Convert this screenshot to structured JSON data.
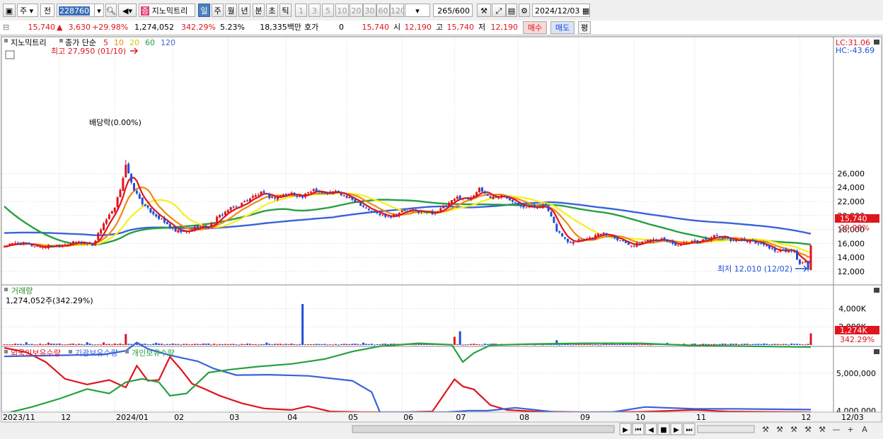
{
  "toolbar": {
    "period_main": "주",
    "prev": "전",
    "stock_code": "228760",
    "stock_name": "지노믹트리",
    "stock_badge": "증",
    "periods": [
      "일",
      "주",
      "월",
      "년",
      "분",
      "초",
      "틱"
    ],
    "selected_period": "일",
    "intervals": [
      "1",
      "3",
      "5",
      "10",
      "20",
      "30",
      "60",
      "120"
    ],
    "count": "265",
    "count_total": "/600",
    "date": "2024/12/03"
  },
  "info": {
    "price": "15,740",
    "change": "3,630",
    "change_pct": "+29.98%",
    "volume": "1,274,052",
    "volume_ratio": "342.29%",
    "turnover": "5.23%",
    "amount": "18,335백만",
    "quote_label": "호가",
    "quote_value": "0",
    "quote_price": "15,740",
    "open_label": "시",
    "open": "12,190",
    "high_label": "고",
    "high": "15,740",
    "low_label": "저",
    "low": "12,190",
    "buy": "매수",
    "sell": "매도",
    "eval": "평"
  },
  "colors": {
    "up": "#e0141e",
    "down": "#1f4fd6",
    "ma5": "#e0141e",
    "ma10": "#f08a10",
    "ma20": "#f5f01e",
    "ma60": "#27a040",
    "ma120": "#3a63d8"
  },
  "legend": {
    "name": "지노믹트리",
    "indicator": "종가 단순",
    "periods": [
      "5",
      "10",
      "20",
      "60",
      "120"
    ]
  },
  "annotations": {
    "high": "최고 27,950 (01/10)",
    "low": "최저 12,010 (12/02)",
    "dividend": "배당락(0.00%)",
    "lc": "LC:31.06",
    "hc": "HC:-43.69",
    "last_price": "15,740",
    "last_pct": "29.98%",
    "volume_title": "거래량",
    "volume_value": "1,274,052주(342.29%)",
    "last_volume": "1,274K",
    "last_volume_pct": "342.29%",
    "holdings_legend": [
      "외국인보유수량",
      "기관보유수량",
      "개인보유수량"
    ]
  },
  "chart_data": [
    {
      "type": "candlestick",
      "title": "지노믹트리 일봉",
      "x_labels": [
        "2023/11",
        "12",
        "2024/01",
        "02",
        "03",
        "04",
        "05",
        "06",
        "07",
        "08",
        "09",
        "10",
        "11",
        "12"
      ],
      "y_ticks": [
        12000,
        14000,
        16000,
        18000,
        20000,
        22000,
        24000,
        26000
      ],
      "ylim": [
        11000,
        28500
      ],
      "anchors": [
        [
          0,
          15600
        ],
        [
          5,
          16100
        ],
        [
          10,
          15700
        ],
        [
          14,
          15500
        ],
        [
          20,
          15800
        ],
        [
          27,
          16200
        ],
        [
          32,
          15800
        ],
        [
          36,
          18900
        ],
        [
          40,
          21000
        ],
        [
          42,
          23800
        ],
        [
          43,
          25500
        ],
        [
          44,
          27300
        ],
        [
          46,
          24500
        ],
        [
          48,
          23000
        ],
        [
          51,
          21200
        ],
        [
          54,
          20300
        ],
        [
          58,
          19000
        ],
        [
          62,
          17700
        ],
        [
          66,
          17600
        ],
        [
          70,
          18500
        ],
        [
          74,
          18300
        ],
        [
          77,
          19600
        ],
        [
          81,
          20800
        ],
        [
          85,
          21400
        ],
        [
          89,
          22500
        ],
        [
          93,
          23200
        ],
        [
          97,
          22500
        ],
        [
          101,
          22900
        ],
        [
          104,
          23200
        ],
        [
          108,
          22600
        ],
        [
          112,
          23800
        ],
        [
          116,
          23000
        ],
        [
          120,
          23400
        ],
        [
          124,
          22600
        ],
        [
          128,
          21900
        ],
        [
          132,
          20800
        ],
        [
          136,
          20100
        ],
        [
          140,
          19900
        ],
        [
          144,
          20600
        ],
        [
          148,
          20700
        ],
        [
          152,
          20400
        ],
        [
          156,
          20400
        ],
        [
          160,
          21400
        ],
        [
          164,
          22600
        ],
        [
          168,
          22400
        ],
        [
          172,
          23700
        ],
        [
          176,
          22600
        ],
        [
          180,
          22800
        ],
        [
          184,
          22200
        ],
        [
          188,
          21300
        ],
        [
          192,
          21200
        ],
        [
          196,
          21400
        ],
        [
          200,
          17900
        ],
        [
          204,
          16200
        ],
        [
          208,
          16600
        ],
        [
          212,
          16800
        ],
        [
          216,
          17400
        ],
        [
          220,
          17100
        ],
        [
          224,
          16300
        ],
        [
          228,
          15700
        ],
        [
          232,
          16400
        ],
        [
          236,
          16700
        ],
        [
          240,
          16300
        ],
        [
          244,
          15700
        ],
        [
          248,
          16100
        ],
        [
          252,
          16300
        ],
        [
          256,
          17000
        ],
        [
          260,
          16900
        ],
        [
          264,
          16500
        ],
        [
          268,
          16500
        ],
        [
          272,
          16200
        ],
        [
          276,
          15600
        ],
        [
          280,
          14800
        ],
        [
          283,
          15000
        ],
        [
          286,
          14700
        ],
        [
          288,
          13000
        ],
        [
          290,
          13300
        ],
        [
          291,
          12400
        ],
        [
          292,
          15740
        ]
      ],
      "annotations": [
        "최고 27,950 (01/10)",
        "최저 12,010 (12/02)",
        "배당락(0.00%)"
      ],
      "moving_averages": [
        5,
        10,
        20,
        60,
        120
      ],
      "last": {
        "price": 15740,
        "open": 12190,
        "high": 15740,
        "low": 12190,
        "change": 3630,
        "change_pct": 29.98
      }
    },
    {
      "type": "bar",
      "title": "거래량",
      "y_ticks": [
        2000000,
        4000000
      ],
      "ylim": [
        0,
        4600000
      ],
      "spikes": [
        [
          8,
          300000
        ],
        [
          16,
          260000
        ],
        [
          30,
          300000
        ],
        [
          36,
          280000
        ],
        [
          44,
          1200000
        ],
        [
          55,
          240000
        ],
        [
          95,
          260000
        ],
        [
          108,
          4500000
        ],
        [
          130,
          250000
        ],
        [
          150,
          230000
        ],
        [
          163,
          900000
        ],
        [
          165,
          1500000
        ],
        [
          200,
          520000
        ],
        [
          240,
          230000
        ],
        [
          292,
          1274052
        ]
      ],
      "last_volume": 1274052,
      "last_volume_ratio_pct": 342.29
    },
    {
      "type": "line",
      "title": "보유수량",
      "series": [
        {
          "name": "외국인보유수량",
          "values": [
            [
              0,
              5680000
            ],
            [
              8,
              5560000
            ],
            [
              15,
              5300000
            ],
            [
              22,
              4850000
            ],
            [
              30,
              4700000
            ],
            [
              38,
              4820000
            ],
            [
              44,
              4620000
            ],
            [
              48,
              5200000
            ],
            [
              52,
              4800000
            ],
            [
              56,
              4820000
            ],
            [
              60,
              5440000
            ],
            [
              64,
              5100000
            ],
            [
              68,
              4720000
            ],
            [
              72,
              4600000
            ],
            [
              78,
              4400000
            ],
            [
              86,
              4200000
            ],
            [
              94,
              4060000
            ],
            [
              104,
              4020000
            ],
            [
              110,
              4120000
            ],
            [
              118,
              3980000
            ],
            [
              130,
              3960000
            ],
            [
              145,
              3960000
            ],
            [
              155,
              3980000
            ],
            [
              163,
              4840000
            ],
            [
              166,
              4650000
            ],
            [
              170,
              4570000
            ],
            [
              176,
              4150000
            ],
            [
              182,
              4020000
            ],
            [
              192,
              3980000
            ],
            [
              210,
              3960000
            ],
            [
              230,
              3970000
            ],
            [
              250,
              4020000
            ],
            [
              262,
              3980000
            ],
            [
              275,
              3970000
            ],
            [
              292,
              3960000
            ]
          ]
        },
        {
          "name": "기관보유수량",
          "values": [
            [
              0,
              5450000
            ],
            [
              20,
              5480000
            ],
            [
              36,
              5500000
            ],
            [
              44,
              5600000
            ],
            [
              48,
              5820000
            ],
            [
              52,
              5650000
            ],
            [
              60,
              5480000
            ],
            [
              70,
              5320000
            ],
            [
              76,
              5120000
            ],
            [
              84,
              4950000
            ],
            [
              96,
              4960000
            ],
            [
              110,
              4930000
            ],
            [
              126,
              4800000
            ],
            [
              133,
              4500000
            ],
            [
              136,
              3960000
            ],
            [
              150,
              3960000
            ],
            [
              160,
              3960000
            ],
            [
              168,
              4000000
            ],
            [
              175,
              4000000
            ],
            [
              185,
              4080000
            ],
            [
              200,
              3960000
            ],
            [
              220,
              3960000
            ],
            [
              232,
              4100000
            ],
            [
              250,
              4050000
            ],
            [
              265,
              4050000
            ],
            [
              292,
              4030000
            ]
          ]
        },
        {
          "name": "개인보유수량",
          "values": [
            [
              0,
              3920000
            ],
            [
              10,
              4100000
            ],
            [
              20,
              4320000
            ],
            [
              30,
              4580000
            ],
            [
              38,
              4460000
            ],
            [
              44,
              4760000
            ],
            [
              50,
              4850000
            ],
            [
              56,
              4760000
            ],
            [
              60,
              4400000
            ],
            [
              66,
              4460000
            ],
            [
              74,
              5020000
            ],
            [
              82,
              5100000
            ],
            [
              92,
              5180000
            ],
            [
              104,
              5250000
            ],
            [
              116,
              5380000
            ],
            [
              126,
              5580000
            ],
            [
              136,
              5720000
            ],
            [
              150,
              5800000
            ],
            [
              162,
              5760000
            ],
            [
              166,
              5300000
            ],
            [
              170,
              5540000
            ],
            [
              176,
              5750000
            ],
            [
              190,
              5780000
            ],
            [
              210,
              5800000
            ],
            [
              230,
              5800000
            ],
            [
              250,
              5740000
            ],
            [
              270,
              5720000
            ],
            [
              292,
              5700000
            ]
          ]
        }
      ],
      "y_ticks": [
        4000000,
        5000000
      ],
      "ylim": [
        3800000,
        6100000
      ]
    }
  ]
}
